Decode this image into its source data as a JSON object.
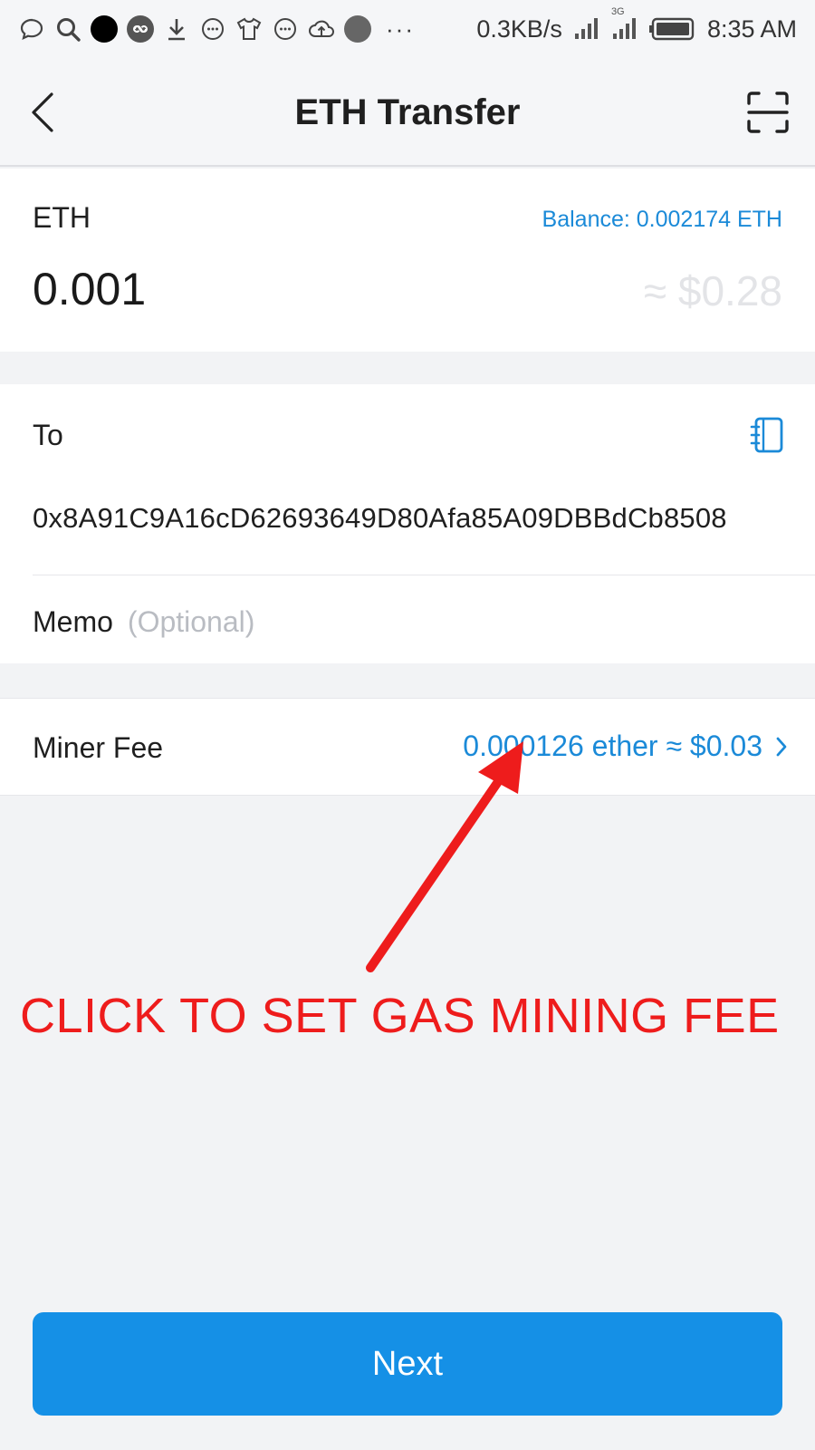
{
  "status_bar": {
    "network_speed": "0.3KB/s",
    "network_type": "3G",
    "time": "8:35 AM",
    "icons": [
      "chat-bubble-icon",
      "search-icon",
      "black-dot-icon",
      "link-icon",
      "download-icon",
      "message-icon",
      "tshirt-icon",
      "message-icon",
      "cloud-upload-icon",
      "grey-dot-icon"
    ],
    "more": "···"
  },
  "header": {
    "title": "ETH Transfer",
    "back_icon": "chevron-left-icon",
    "scan_icon": "scan-icon"
  },
  "amount": {
    "asset": "ETH",
    "balance": "Balance: 0.002174 ETH",
    "value": "0.001",
    "fiat": "≈ $0.28"
  },
  "recipient": {
    "label": "To",
    "address_book_icon": "address-book-icon",
    "address": "0x8A91C9A16cD62693649D80Afa85A09DBBdCb8508"
  },
  "memo": {
    "label": "Memo",
    "placeholder": "(Optional)",
    "value": ""
  },
  "miner_fee": {
    "label": "Miner Fee",
    "value": "0.000126 ether ≈ $0.03",
    "chevron_icon": "chevron-right-icon"
  },
  "annotation": {
    "text": "CLICK TO SET GAS MINING FEE",
    "color": "#ee1c1c"
  },
  "next_button": {
    "label": "Next"
  },
  "colors": {
    "accent": "#1590e6",
    "link": "#1b8ad8",
    "background": "#f2f3f5"
  }
}
